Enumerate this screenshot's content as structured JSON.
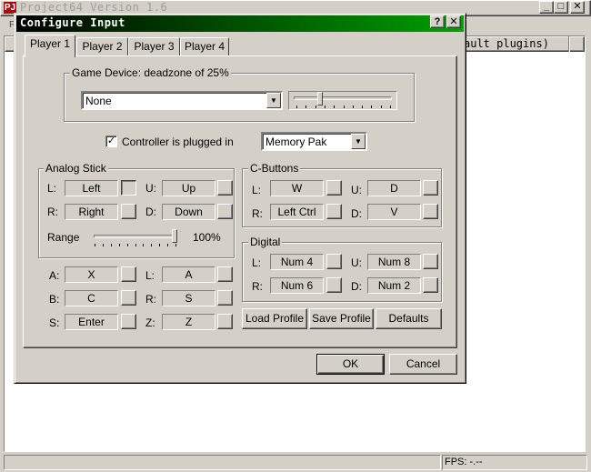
{
  "main_window": {
    "title": "Project64 Version 1.6",
    "menu_fragment": "F",
    "list_header_fragment": "ault plugins)",
    "status_fps": "FPS: -.--",
    "controls": {
      "minimize": "_",
      "maximize": "□",
      "close": "✕"
    }
  },
  "dialog": {
    "title": "Configure Input",
    "help_label": "?",
    "close_label": "✕",
    "tabs": [
      {
        "label": "Player 1",
        "active": true
      },
      {
        "label": "Player 2",
        "active": false
      },
      {
        "label": "Player 3",
        "active": false
      },
      {
        "label": "Player 4",
        "active": false
      }
    ],
    "game_device": {
      "label": "Game Device: deadzone of 25%",
      "selected": "None",
      "deadzone_percent": 25
    },
    "controller_plugged": {
      "label": "Controller is plugged in",
      "checked": true
    },
    "pak": {
      "selected": "Memory Pak"
    },
    "analog_stick": {
      "label": "Analog Stick",
      "L": {
        "label": "L:",
        "key": "Left"
      },
      "R": {
        "label": "R:",
        "key": "Right"
      },
      "U": {
        "label": "U:",
        "key": "Up"
      },
      "D": {
        "label": "D:",
        "key": "Down"
      },
      "range_label": "Range",
      "range_value": "100%",
      "range_percent": 100
    },
    "c_buttons": {
      "label": "C-Buttons",
      "L": {
        "label": "L:",
        "key": "W"
      },
      "R": {
        "label": "R:",
        "key": "Left Ctrl"
      },
      "U": {
        "label": "U:",
        "key": "D"
      },
      "D": {
        "label": "D:",
        "key": "V"
      }
    },
    "digital": {
      "label": "Digital",
      "L": {
        "label": "L:",
        "key": "Num 4"
      },
      "R": {
        "label": "R:",
        "key": "Num 6"
      },
      "U": {
        "label": "U:",
        "key": "Num 8"
      },
      "D": {
        "label": "D:",
        "key": "Num 2"
      }
    },
    "buttons": {
      "A": {
        "label": "A:",
        "key": "X"
      },
      "B": {
        "label": "B:",
        "key": "C"
      },
      "S": {
        "label": "S:",
        "key": "Enter"
      },
      "L": {
        "label": "L:",
        "key": "A"
      },
      "R": {
        "label": "R:",
        "key": "S"
      },
      "Z": {
        "label": "Z:",
        "key": "Z"
      }
    },
    "actions": {
      "load_profile": "Load Profile",
      "save_profile": "Save Profile",
      "defaults": "Defaults",
      "ok": "OK",
      "cancel": "Cancel"
    }
  }
}
